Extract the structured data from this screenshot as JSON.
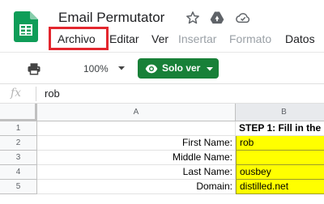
{
  "header": {
    "title": "Email Permutator",
    "icons": [
      "sheets-logo-icon",
      "star-icon",
      "move-to-drive-icon",
      "cloud-saved-icon"
    ]
  },
  "menu": [
    {
      "label": "Archivo",
      "enabled": true,
      "highlighted": true
    },
    {
      "label": "Editar",
      "enabled": true
    },
    {
      "label": "Ver",
      "enabled": true
    },
    {
      "label": "Insertar",
      "enabled": false
    },
    {
      "label": "Formato",
      "enabled": false
    },
    {
      "label": "Datos",
      "enabled": true
    }
  ],
  "toolbar": {
    "zoom": "100%",
    "view_only_label": "Solo ver",
    "view_only_color": "#188038"
  },
  "formula_bar": {
    "fx_label": "fx",
    "content": "rob"
  },
  "grid": {
    "columns": [
      "A",
      "B"
    ],
    "rows": [
      {
        "num": "1",
        "a": "",
        "b": "STEP 1: Fill in the"
      },
      {
        "num": "2",
        "a": "First Name:",
        "b": "rob"
      },
      {
        "num": "3",
        "a": "Middle Name:",
        "b": ""
      },
      {
        "num": "4",
        "a": "Last Name:",
        "b": "ousbey"
      },
      {
        "num": "5",
        "a": "Domain:",
        "b": "distilled.net"
      }
    ],
    "input_fill_color": "#ffff00",
    "highlight_color": "#e3262e"
  }
}
